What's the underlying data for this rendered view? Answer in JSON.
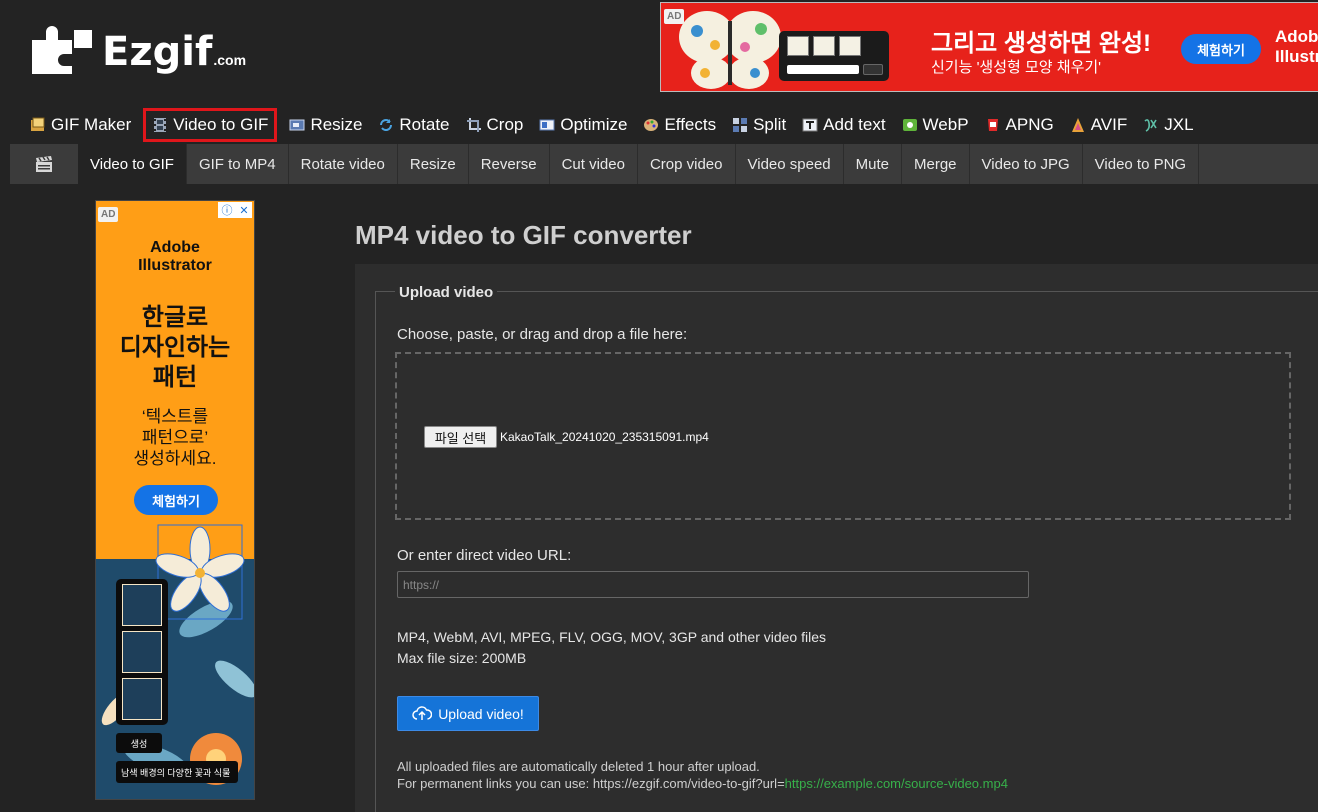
{
  "header": {
    "logo_text": "Ezgif",
    "logo_suffix": ".com"
  },
  "top_ad": {
    "tag": "AD",
    "headline": "그리고 생성하면 완성!",
    "subline": "신기능 '생성형 모양 채우기'",
    "cta": "체험하기",
    "brand": "Adobe Illustrator",
    "colors": {
      "background": "#e7221b",
      "cta": "#1473e6"
    }
  },
  "main_nav": [
    {
      "label": "GIF Maker",
      "icon": "gif-maker-icon"
    },
    {
      "label": "Video to GIF",
      "icon": "film-icon",
      "active": true
    },
    {
      "label": "Resize",
      "icon": "resize-icon"
    },
    {
      "label": "Rotate",
      "icon": "rotate-icon"
    },
    {
      "label": "Crop",
      "icon": "crop-icon"
    },
    {
      "label": "Optimize",
      "icon": "optimize-icon"
    },
    {
      "label": "Effects",
      "icon": "palette-icon"
    },
    {
      "label": "Split",
      "icon": "split-icon"
    },
    {
      "label": "Add text",
      "icon": "add-text-icon"
    },
    {
      "label": "WebP",
      "icon": "webp-icon"
    },
    {
      "label": "APNG",
      "icon": "apng-icon"
    },
    {
      "label": "AVIF",
      "icon": "avif-icon"
    },
    {
      "label": "JXL",
      "icon": "jxl-icon"
    }
  ],
  "sub_nav": [
    {
      "label": "Video to GIF",
      "active": true
    },
    {
      "label": "GIF to MP4"
    },
    {
      "label": "Rotate video"
    },
    {
      "label": "Resize"
    },
    {
      "label": "Reverse"
    },
    {
      "label": "Cut video"
    },
    {
      "label": "Crop video"
    },
    {
      "label": "Video speed"
    },
    {
      "label": "Mute"
    },
    {
      "label": "Merge"
    },
    {
      "label": "Video to JPG"
    },
    {
      "label": "Video to PNG"
    }
  ],
  "side_ad": {
    "tag": "AD",
    "brand_line1": "Adobe",
    "brand_line2": "Illustrator",
    "headline_lines": [
      "한글로",
      "디자인하는",
      "패턴"
    ],
    "sub_lines": [
      "‘텍스트를",
      "패턴으로’",
      "생성하세요."
    ],
    "cta": "체험하기",
    "generate_label": "생성",
    "prompt_text": "남색 배경의 다양한 꽃과 식물",
    "colors": {
      "background": "#ff9e16",
      "pattern": "#1f4b6b"
    }
  },
  "main": {
    "title": "MP4 video to GIF converter",
    "legend": "Upload video",
    "choose_label": "Choose, paste, or drag and drop a file here:",
    "file_button": "파일 선택",
    "file_name": "KakaoTalk_20241020_235315091.mp4",
    "url_label": "Or enter direct video URL:",
    "url_placeholder": "https://",
    "formats_line": "MP4, WebM, AVI, MPEG, FLV, OGG, MOV, 3GP and other video files",
    "max_size_line": "Max file size: 200MB",
    "upload_button": "Upload video!",
    "note_line1": "All uploaded files are automatically deleted 1 hour after upload.",
    "note_line2_prefix": "For permanent links you can use: https://ezgif.com/video-to-gif?url=",
    "note_line2_link": "https://example.com/source-video.mp4",
    "colors": {
      "accent": "#1574d8",
      "link": "#37b04a",
      "active_outline": "#e0161b"
    }
  }
}
